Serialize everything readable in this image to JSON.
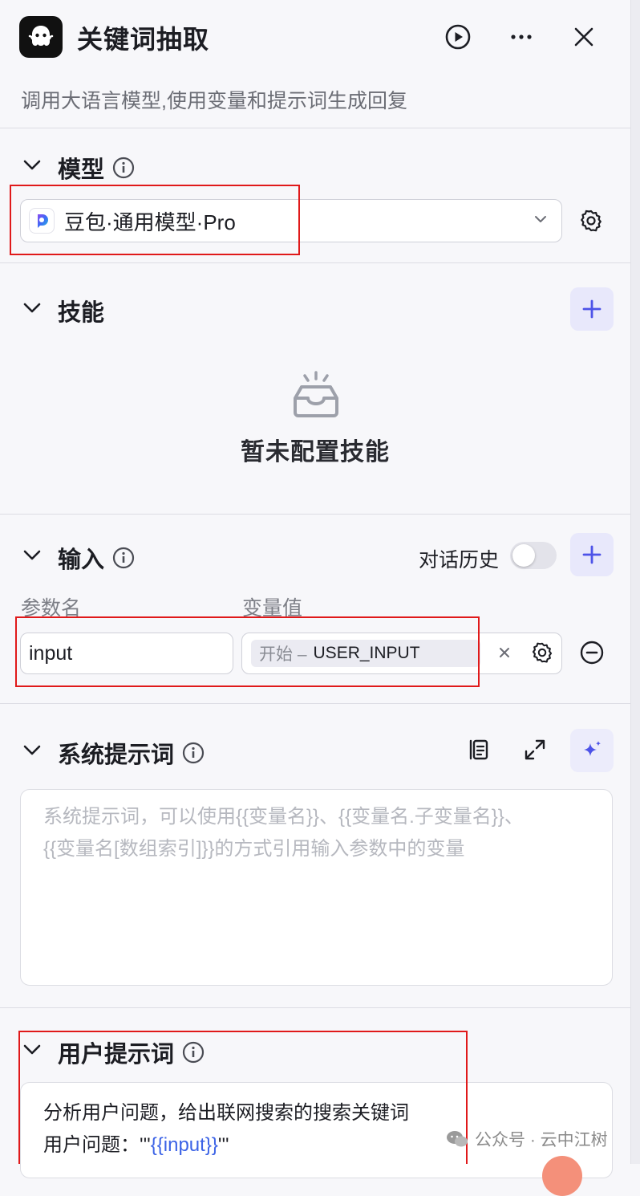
{
  "header": {
    "title": "关键词抽取",
    "subtitle": "调用大语言模型,使用变量和提示词生成回复",
    "icons": [
      "bot-logo-icon",
      "play-icon",
      "more-icon",
      "close-icon"
    ]
  },
  "model": {
    "title": "模型",
    "selected": "豆包·通用模型·Pro"
  },
  "skills": {
    "title": "技能",
    "empty_text": "暂未配置技能"
  },
  "input": {
    "title": "输入",
    "history_label": "对话历史",
    "history_enabled": false,
    "col_name": "参数名",
    "col_value": "变量值",
    "rows": [
      {
        "name": "input",
        "source": "开始 –",
        "variable": "USER_INPUT"
      }
    ]
  },
  "system_prompt": {
    "title": "系统提示词",
    "placeholder_line1": "系统提示词，可以使用{{变量名}}、{{变量名.子变量名}}、",
    "placeholder_line2": "{{变量名[数组索引]}}的方式引用输入参数中的变量"
  },
  "user_prompt": {
    "title": "用户提示词",
    "line1": "分析用户问题，给出联网搜索的搜索关键词",
    "line2_prefix": "用户问题：'''",
    "line2_var": "{{input}}",
    "line2_suffix": "'''"
  },
  "watermark": "公众号 · 云中江树",
  "colors": {
    "accent": "#4d53e8",
    "highlight": "#e0191a",
    "link": "#3c63e6"
  }
}
